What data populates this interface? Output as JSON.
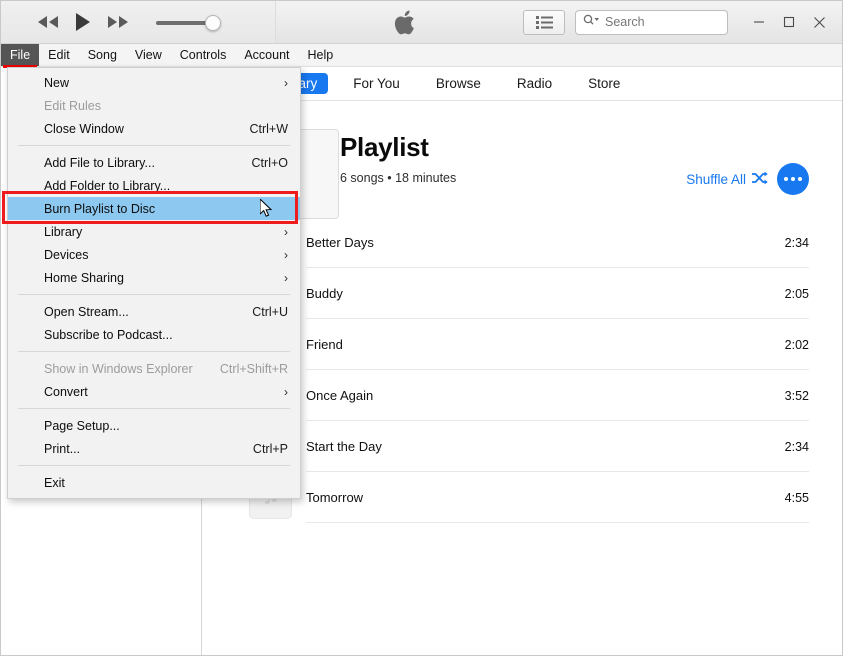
{
  "window": {
    "minimize_label": "─",
    "maximize_label": "□",
    "close_label": "✕"
  },
  "toolbar": {
    "rewind_icon": "rewind-icon",
    "play_icon": "play-icon",
    "fastforward_icon": "fast-forward-icon",
    "volume_slider_name": "volume-slider",
    "volume_value": 84,
    "apple_logo_icon": "apple-logo-icon",
    "list_view_icon": "list-view-icon"
  },
  "search": {
    "placeholder": "Search",
    "value": "",
    "icon": "search-magnifier-icon"
  },
  "menubar": {
    "items": [
      {
        "label": "File",
        "active": true
      },
      {
        "label": "Edit",
        "active": false
      },
      {
        "label": "Song",
        "active": false
      },
      {
        "label": "View",
        "active": false
      },
      {
        "label": "Controls",
        "active": false
      },
      {
        "label": "Account",
        "active": false
      },
      {
        "label": "Help",
        "active": false
      }
    ]
  },
  "file_menu": {
    "items": [
      {
        "label": "New",
        "accel": "",
        "submenu": true,
        "disabled": false,
        "highlight": false,
        "sep_after": false
      },
      {
        "label": "Edit Rules",
        "accel": "",
        "submenu": false,
        "disabled": true,
        "highlight": false,
        "sep_after": false
      },
      {
        "label": "Close Window",
        "accel": "Ctrl+W",
        "submenu": false,
        "disabled": false,
        "highlight": false,
        "sep_after": true
      },
      {
        "label": "Add File to Library...",
        "accel": "Ctrl+O",
        "submenu": false,
        "disabled": false,
        "highlight": false,
        "sep_after": false
      },
      {
        "label": "Add Folder to Library...",
        "accel": "",
        "submenu": false,
        "disabled": false,
        "highlight": false,
        "sep_after": false
      },
      {
        "label": "Burn Playlist to Disc",
        "accel": "",
        "submenu": false,
        "disabled": false,
        "highlight": true,
        "sep_after": false
      },
      {
        "label": "Library",
        "accel": "",
        "submenu": true,
        "disabled": false,
        "highlight": false,
        "sep_after": false
      },
      {
        "label": "Devices",
        "accel": "",
        "submenu": true,
        "disabled": false,
        "highlight": false,
        "sep_after": false
      },
      {
        "label": "Home Sharing",
        "accel": "",
        "submenu": true,
        "disabled": false,
        "highlight": false,
        "sep_after": true
      },
      {
        "label": "Open Stream...",
        "accel": "Ctrl+U",
        "submenu": false,
        "disabled": false,
        "highlight": false,
        "sep_after": false
      },
      {
        "label": "Subscribe to Podcast...",
        "accel": "",
        "submenu": false,
        "disabled": false,
        "highlight": false,
        "sep_after": true
      },
      {
        "label": "Show in Windows Explorer",
        "accel": "Ctrl+Shift+R",
        "submenu": false,
        "disabled": true,
        "highlight": false,
        "sep_after": false
      },
      {
        "label": "Convert",
        "accel": "",
        "submenu": true,
        "disabled": false,
        "highlight": false,
        "sep_after": true
      },
      {
        "label": "Page Setup...",
        "accel": "",
        "submenu": false,
        "disabled": false,
        "highlight": false,
        "sep_after": false
      },
      {
        "label": "Print...",
        "accel": "Ctrl+P",
        "submenu": false,
        "disabled": false,
        "highlight": false,
        "sep_after": true
      },
      {
        "label": "Exit",
        "accel": "",
        "submenu": false,
        "disabled": false,
        "highlight": false,
        "sep_after": false
      }
    ],
    "submenu_arrow": "›",
    "annotation_color": "#ee1c1c",
    "highlight_color": "#8cc8f0"
  },
  "tabs": [
    {
      "label": "Library",
      "active": true
    },
    {
      "label": "For You",
      "active": false
    },
    {
      "label": "Browse",
      "active": false
    },
    {
      "label": "Radio",
      "active": false
    },
    {
      "label": "Store",
      "active": false
    }
  ],
  "playlist": {
    "title": "Playlist",
    "subtitle": "6 songs • 18 minutes",
    "shuffle_label": "Shuffle All",
    "shuffle_icon": "shuffle-icon",
    "more_icon": "more-options-icon",
    "accent_color": "#1878f0",
    "songs": [
      {
        "name": "Better Days",
        "time": "2:34"
      },
      {
        "name": "Buddy",
        "time": "2:05"
      },
      {
        "name": "Friend",
        "time": "2:02"
      },
      {
        "name": "Once Again",
        "time": "3:52"
      },
      {
        "name": "Start the Day",
        "time": "2:34"
      },
      {
        "name": "Tomorrow",
        "time": "4:55"
      }
    ]
  }
}
